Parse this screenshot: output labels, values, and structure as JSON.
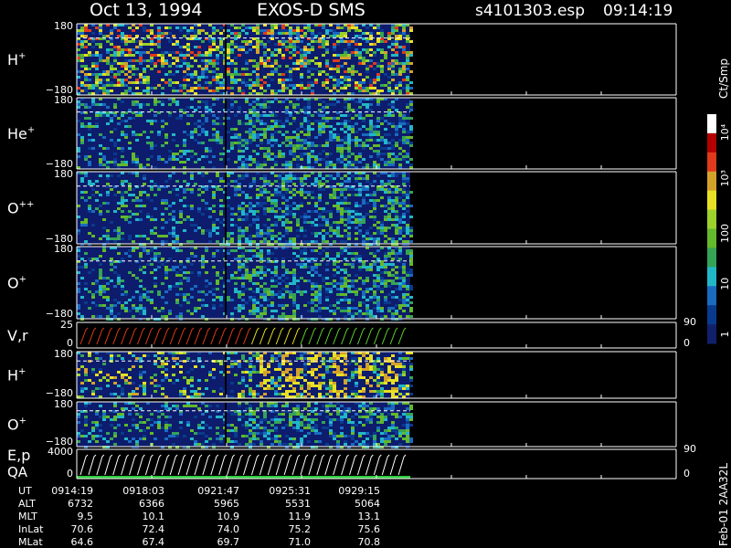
{
  "header": {
    "date": "Oct 13, 1994",
    "title": "EXOS-D SMS",
    "file": "s4101303.esp",
    "time": "09:14:19"
  },
  "colorbar": {
    "unit": "Ct/Smp",
    "ticks": [
      "10⁴",
      "10³",
      "100",
      "10",
      "1"
    ]
  },
  "side_note": "Feb-01 2AA32L",
  "chart_data": {
    "type": "heatmap",
    "time_axis": [
      "0914:19",
      "0918:03",
      "0921:47",
      "0925:31",
      "0929:15"
    ],
    "panels": [
      {
        "name": "H+",
        "label": "H",
        "sup": "+",
        "yrange": [
          -180,
          180
        ],
        "ticks": [
          "180",
          "−180"
        ]
      },
      {
        "name": "He+",
        "label": "He",
        "sup": "+",
        "yrange": [
          -180,
          180
        ],
        "ticks": [
          "180",
          "−180"
        ]
      },
      {
        "name": "O++",
        "label": "O",
        "sup": "++",
        "yrange": [
          -180,
          180
        ],
        "ticks": [
          "180",
          "−180"
        ]
      },
      {
        "name": "O+",
        "label": "O",
        "sup": "+",
        "yrange": [
          -180,
          180
        ],
        "ticks": [
          "180",
          "−180"
        ]
      },
      {
        "name": "V,r",
        "label": "V,r",
        "sup": "",
        "yrange": [
          0,
          25
        ],
        "ticks": [
          "25",
          "0"
        ],
        "right_ticks": [
          "90",
          "0"
        ]
      },
      {
        "name": "H+ (2)",
        "label": "H",
        "sup": "+",
        "yrange": [
          -180,
          180
        ],
        "ticks": [
          "180",
          "−180"
        ]
      },
      {
        "name": "O+ (2)",
        "label": "O",
        "sup": "+",
        "yrange": [
          -180,
          180
        ],
        "ticks": [
          "180",
          "−180"
        ]
      },
      {
        "name": "E,p QA",
        "label": "E,p",
        "label2": "QA",
        "sup": "",
        "yrange": [
          0,
          4000
        ],
        "ticks": [
          "4000",
          "0"
        ],
        "right_ticks": [
          "90",
          "0"
        ]
      }
    ],
    "orbit_table": {
      "rows": [
        {
          "label": "UT",
          "values": [
            "0914:19",
            "0918:03",
            "0921:47",
            "0925:31",
            "0929:15"
          ]
        },
        {
          "label": "ALT",
          "values": [
            "6732",
            "6366",
            "5965",
            "5531",
            "5064"
          ]
        },
        {
          "label": "MLT",
          "values": [
            "9.5",
            "10.1",
            "10.9",
            "11.9",
            "13.1"
          ]
        },
        {
          "label": "InLat",
          "values": [
            "70.6",
            "72.4",
            "74.0",
            "75.2",
            "75.6"
          ]
        },
        {
          "label": "MLat",
          "values": [
            "64.6",
            "67.4",
            "69.7",
            "71.0",
            "70.8"
          ]
        }
      ]
    },
    "colorbar_range": [
      1,
      10000
    ],
    "colorbar_scale": "log"
  }
}
